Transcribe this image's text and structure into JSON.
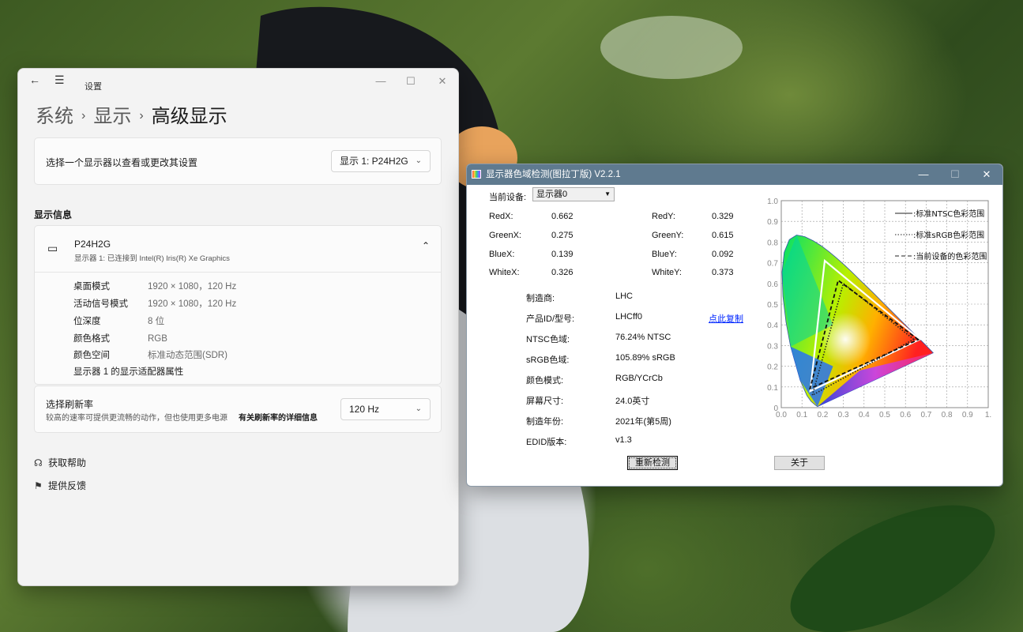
{
  "settings": {
    "title": "设置",
    "window_controls": {
      "minimize": "—",
      "maximize": "☐",
      "close": "✕"
    },
    "breadcrumb": [
      "系统",
      "显示",
      "高级显示"
    ],
    "breadcrumb_separator": "›",
    "select_display": {
      "label": "选择一个显示器以查看或更改其设置",
      "value": "显示 1: P24H2G"
    },
    "display_info": {
      "section_title": "显示信息",
      "monitor_name": "P24H2G",
      "monitor_sub": "显示器 1: 已连接到 Intel(R) Iris(R) Xe Graphics",
      "rows": [
        {
          "key": "桌面模式",
          "value": "1920 × 1080，120 Hz"
        },
        {
          "key": "活动信号模式",
          "value": "1920 × 1080，120 Hz"
        },
        {
          "key": "位深度",
          "value": "8 位"
        },
        {
          "key": "颜色格式",
          "value": "RGB"
        },
        {
          "key": "颜色空间",
          "value": "标准动态范围(SDR)"
        }
      ],
      "adapter_link": "显示器 1 的显示适配器属性"
    },
    "refresh": {
      "title": "选择刷新率",
      "desc": "较高的速率可提供更流畅的动作，但也使用更多电源",
      "more_link": "有关刷新率的详细信息",
      "value": "120 Hz"
    },
    "help_links": {
      "get_help": "获取帮助",
      "feedback": "提供反馈"
    }
  },
  "gamut": {
    "title": "显示器色域检测(图拉丁版) V2.2.1",
    "window_controls": {
      "minimize": "—",
      "maximize": "☐",
      "close": "✕"
    },
    "device_label": "当前设备:",
    "device_value": "显示器0",
    "coords": {
      "RedX": "0.662",
      "RedY": "0.329",
      "GreenX": "0.275",
      "GreenY": "0.615",
      "BlueX": "0.139",
      "BlueY": "0.092",
      "WhiteX": "0.326",
      "WhiteY": "0.373"
    },
    "coord_labels": {
      "RedX": "RedX:",
      "RedY": "RedY:",
      "GreenX": "GreenX:",
      "GreenY": "GreenY:",
      "BlueX": "BlueX:",
      "BlueY": "BlueY:",
      "WhiteX": "WhiteX:",
      "WhiteY": "WhiteY:"
    },
    "details": [
      {
        "key": "制造商:",
        "value": "LHC"
      },
      {
        "key": "产品ID/型号:",
        "value": "LHCff0"
      },
      {
        "key": "NTSC色域:",
        "value": "76.24% NTSC"
      },
      {
        "key": "sRGB色域:",
        "value": "105.89% sRGB"
      },
      {
        "key": "颜色模式:",
        "value": "RGB/YCrCb"
      },
      {
        "key": "屏幕尺寸:",
        "value": "24.0英寸"
      },
      {
        "key": "制造年份:",
        "value": "2021年(第5周)"
      },
      {
        "key": "EDID版本:",
        "value": "v1.3"
      }
    ],
    "copy_link": "点此复制",
    "buttons": {
      "redetect": "重新检测",
      "about": "关于"
    }
  },
  "chart_data": {
    "type": "scatter",
    "title": "",
    "xlabel": "",
    "ylabel": "",
    "xlim": [
      0,
      1.0
    ],
    "ylim": [
      0,
      1.0
    ],
    "x_ticks": [
      "0.0",
      "0.1",
      "0.2",
      "0.3",
      "0.4",
      "0.5",
      "0.6",
      "0.7",
      "0.8",
      "0.9",
      "1."
    ],
    "y_ticks": [
      "0",
      "0.1",
      "0.2",
      "0.3",
      "0.4",
      "0.5",
      "0.6",
      "0.7",
      "0.8",
      "0.9",
      "1.0"
    ],
    "grid": true,
    "legend": "top-right",
    "series": [
      {
        "name": "标准NTSC色彩范围",
        "style": "solid",
        "color": "#ffffff",
        "points": [
          [
            0.67,
            0.33
          ],
          [
            0.21,
            0.71
          ],
          [
            0.14,
            0.08
          ]
        ]
      },
      {
        "name": "标准sRGB色彩范围",
        "style": "dotted",
        "color": "#222222",
        "points": [
          [
            0.64,
            0.33
          ],
          [
            0.3,
            0.6
          ],
          [
            0.15,
            0.06
          ]
        ]
      },
      {
        "name": "当前设备的色彩范围",
        "style": "dashed",
        "color": "#111111",
        "points": [
          [
            0.662,
            0.329
          ],
          [
            0.275,
            0.615
          ],
          [
            0.139,
            0.092
          ]
        ]
      }
    ],
    "white_point": [
      0.326,
      0.373
    ]
  }
}
